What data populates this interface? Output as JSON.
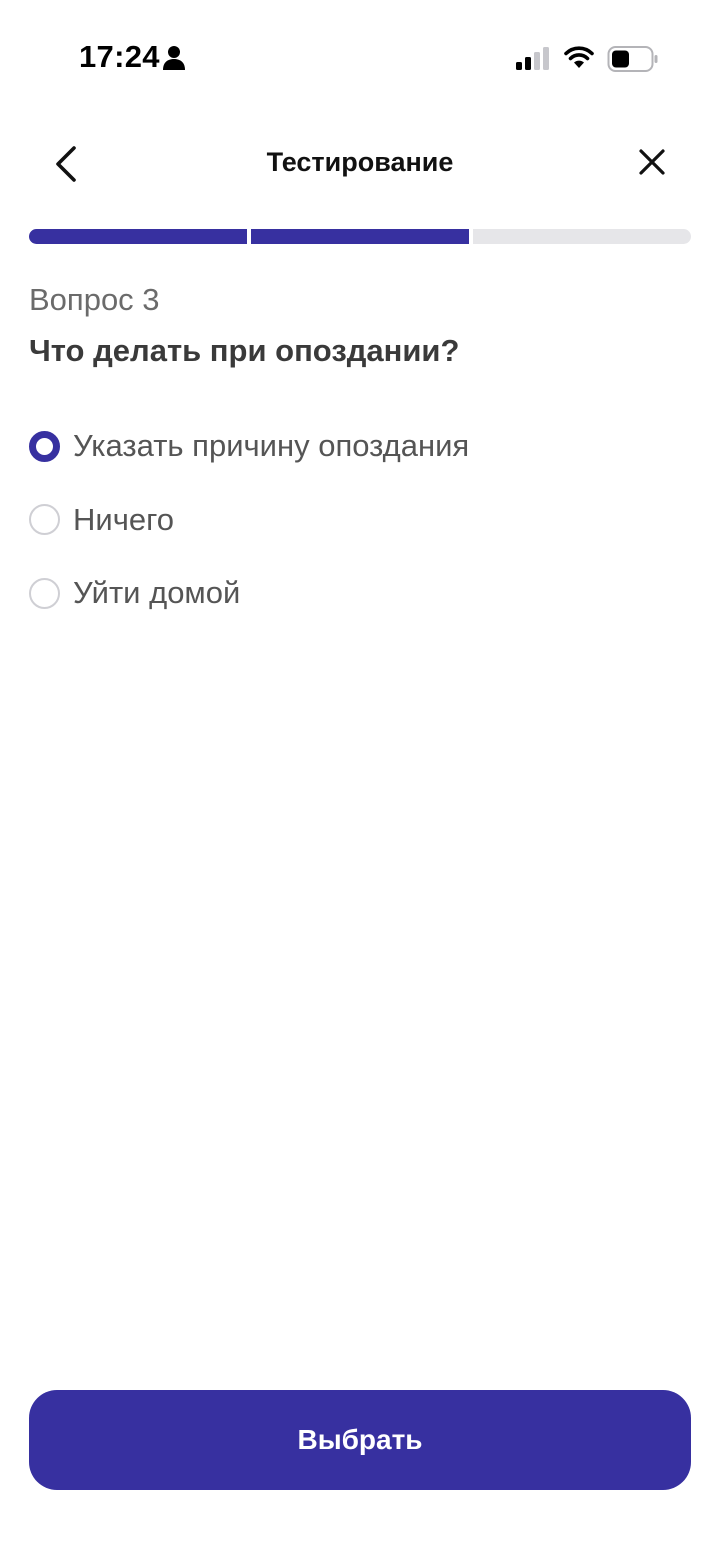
{
  "status_bar": {
    "time": "17:24",
    "icons": [
      "person-icon",
      "cellular-signal-icon",
      "wifi-icon",
      "battery-icon"
    ]
  },
  "header": {
    "title": "Тестирование",
    "back_icon": "chevron-left-icon",
    "close_icon": "close-icon"
  },
  "progress": {
    "total_steps": 3,
    "completed_steps": 2,
    "active_color": "#3730a0",
    "inactive_color": "#e6e6e9"
  },
  "question": {
    "number_label": "Вопрос 3",
    "text": "Что делать при опоздании?"
  },
  "options": [
    {
      "label": "Указать причину опоздания",
      "selected": true
    },
    {
      "label": "Ничего",
      "selected": false
    },
    {
      "label": "Уйти домой",
      "selected": false
    }
  ],
  "actions": {
    "submit_label": "Выбрать"
  },
  "colors": {
    "accent": "#3730a0",
    "background": "#ffffff"
  }
}
